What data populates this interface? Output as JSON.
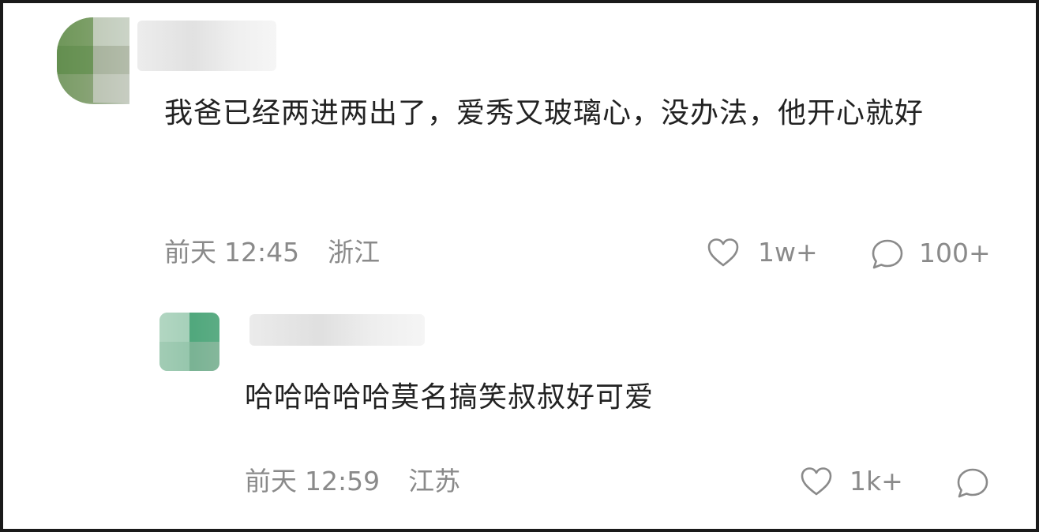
{
  "comment": {
    "text": "我爸已经两进两出了，爱秀又玻璃心，没办法，他开心就好",
    "date": "前天",
    "time": "12:45",
    "location": "浙江",
    "likes": "1w+",
    "replies": "100+"
  },
  "reply": {
    "text": "哈哈哈哈哈莫名搞笑叔叔好可爱",
    "date": "前天",
    "time": "12:59",
    "location": "江苏",
    "likes": "1k+"
  },
  "icons": {
    "like": "heart-outline-icon",
    "reply": "speech-bubble-icon"
  },
  "colors": {
    "text": "#222222",
    "meta": "#8a8a8a",
    "frame": "#1a1a1a"
  }
}
